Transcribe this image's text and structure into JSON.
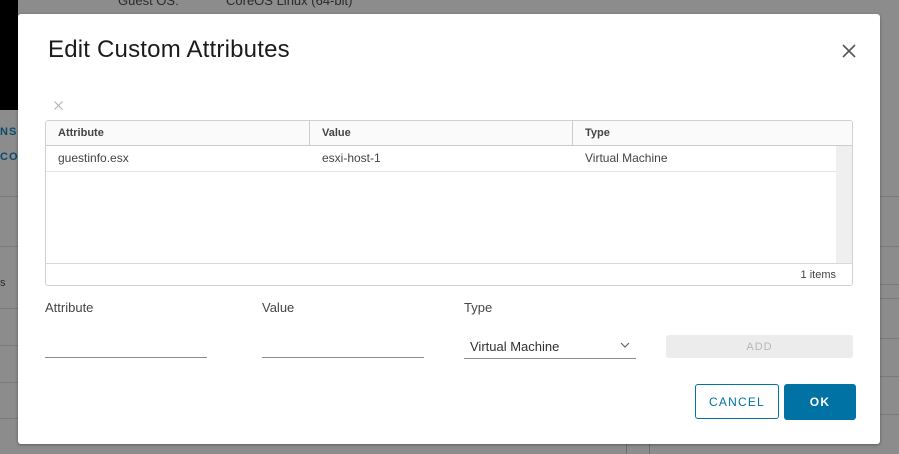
{
  "background": {
    "guest_os_label": "Guest OS:",
    "guest_os_value": "CoreOS Linux (64-bit)",
    "link_fragment_1": "NSO",
    "link_fragment_2": "CO",
    "side_char": "s"
  },
  "dialog": {
    "title": "Edit Custom Attributes",
    "grid": {
      "columns": [
        "Attribute",
        "Value",
        "Type"
      ],
      "rows": [
        {
          "attribute": "guestinfo.esx",
          "value": "esxi-host-1",
          "type": "Virtual Machine"
        }
      ],
      "footer_count": "1 items"
    },
    "form": {
      "attribute_label": "Attribute",
      "attribute_value": "",
      "value_label": "Value",
      "value_value": "",
      "type_label": "Type",
      "type_selected": "Virtual Machine",
      "add_label": "ADD"
    },
    "buttons": {
      "cancel": "CANCEL",
      "ok": "OK"
    }
  },
  "colors": {
    "primary": "#0072a3",
    "overlay": "#8c8c8c",
    "disabled_bg": "#ececec"
  },
  "icons": {
    "close": "close-icon",
    "remove": "remove-icon",
    "dropdown": "chevron-down-icon"
  }
}
